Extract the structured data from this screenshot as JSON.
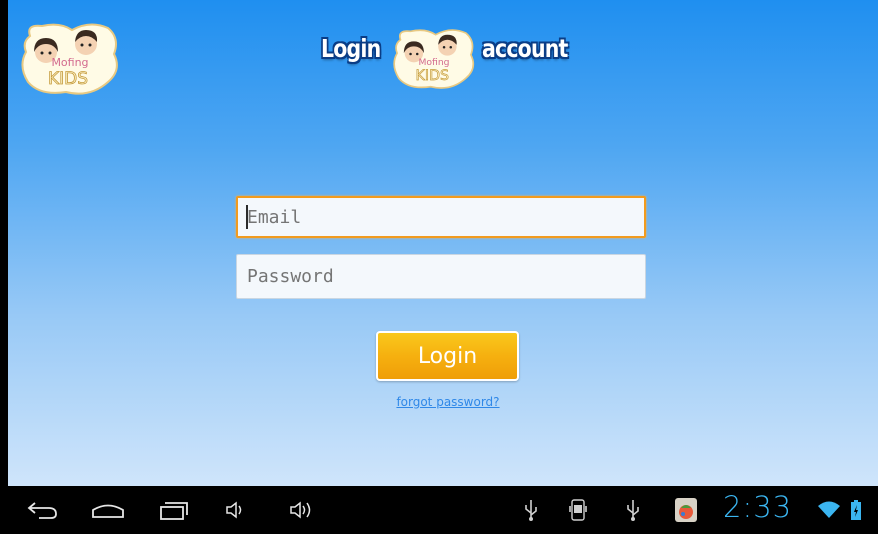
{
  "header": {
    "title_left": "Login",
    "title_right": "account",
    "logo_text_top": "Mofing",
    "logo_text_bottom": "KIDS"
  },
  "form": {
    "email_placeholder": "Email",
    "password_placeholder": "Password",
    "login_label": "Login",
    "forgot_label": "forgot password?"
  },
  "statusbar": {
    "time": "2:33"
  },
  "icons": {
    "back": "back-icon",
    "home": "home-icon",
    "recents": "recent-apps-icon",
    "volume_down": "volume-down-icon",
    "volume_up": "volume-up-icon",
    "usb": "usb-icon",
    "debug": "android-debug-icon",
    "app": "app-notification-icon",
    "wifi": "wifi-icon",
    "battery": "battery-charging-icon"
  },
  "colors": {
    "accent": "#f29b1e",
    "button": "#f6b00f",
    "link": "#2f88e8",
    "clock": "#3bb5f0"
  }
}
